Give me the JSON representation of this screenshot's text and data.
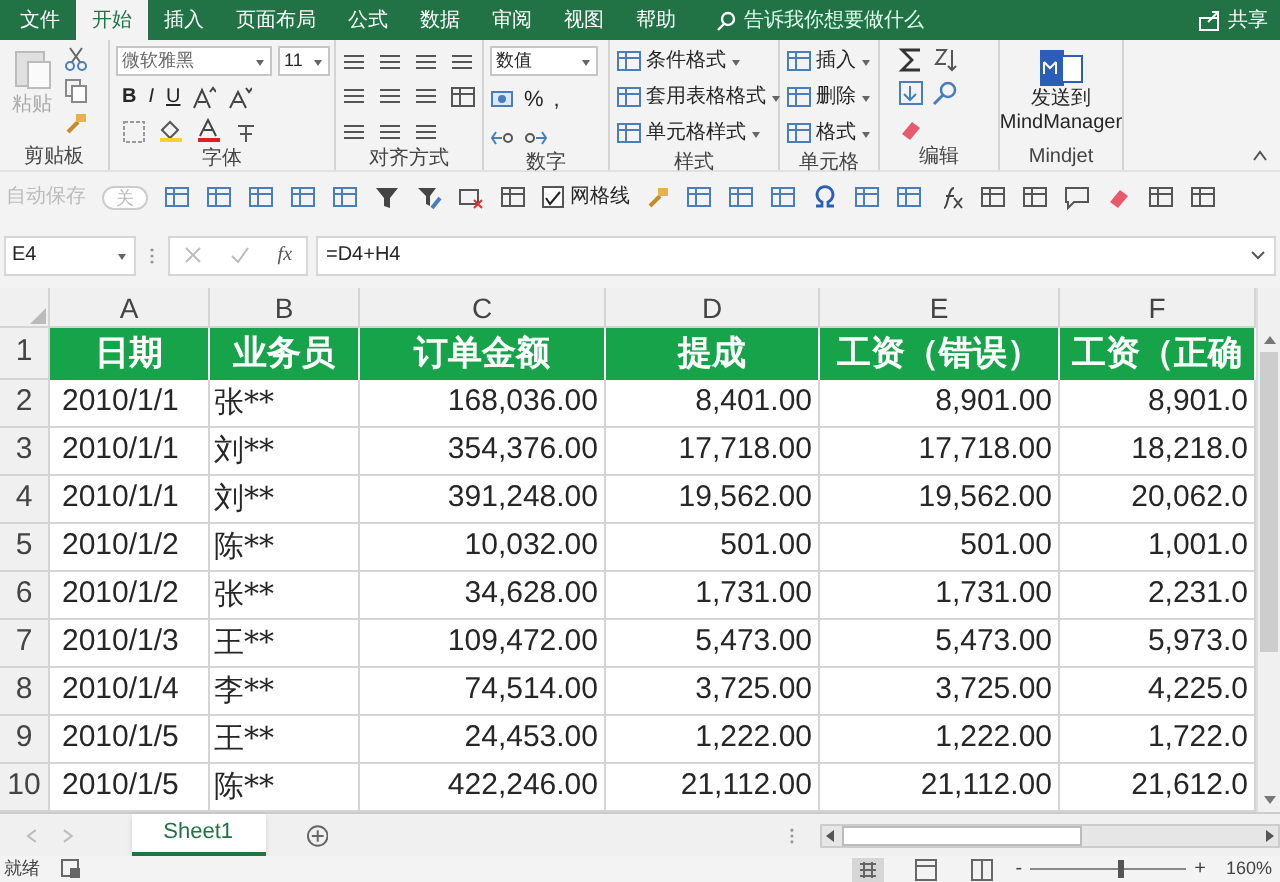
{
  "ribbon_tabs": [
    {
      "label": "文件",
      "selected": false
    },
    {
      "label": "开始",
      "selected": true
    },
    {
      "label": "插入",
      "selected": false
    },
    {
      "label": "页面布局",
      "selected": false
    },
    {
      "label": "公式",
      "selected": false
    },
    {
      "label": "数据",
      "selected": false
    },
    {
      "label": "审阅",
      "selected": false
    },
    {
      "label": "视图",
      "selected": false
    },
    {
      "label": "帮助",
      "selected": false
    }
  ],
  "tell_me": {
    "placeholder": "告诉我你想要做什么"
  },
  "share": "共享",
  "ribbon": {
    "clipboard": {
      "label": "剪贴板",
      "paste": "粘贴"
    },
    "font": {
      "label": "字体",
      "font_name": "微软雅黑",
      "font_size": "11",
      "styles": [
        "B",
        "I",
        "U"
      ]
    },
    "alignment": {
      "label": "对齐方式"
    },
    "number": {
      "label": "数字",
      "format": "数值",
      "symbols": [
        "%",
        ","
      ]
    },
    "styles": {
      "label": "样式",
      "items": [
        "条件格式",
        "套用表格格式",
        "单元格样式"
      ]
    },
    "cells": {
      "label": "单元格",
      "items": [
        "插入",
        "删除",
        "格式"
      ]
    },
    "editing": {
      "label": "编辑"
    },
    "mindjet": {
      "label": "Mindjet",
      "button": [
        "发送到",
        "MindManager"
      ]
    }
  },
  "quick_access": {
    "autosave": "自动保存",
    "autosave_toggle": "关",
    "gridlines": {
      "label": "网格线",
      "checked": true
    }
  },
  "formula_bar": {
    "name_box": "E4",
    "fx": "fx",
    "formula": "=D4+H4"
  },
  "sheet": {
    "columns": [
      "A",
      "B",
      "C",
      "D",
      "E",
      "F"
    ],
    "row_numbers": [
      "1",
      "2",
      "3",
      "4",
      "5",
      "6",
      "7",
      "8",
      "9",
      "10"
    ],
    "header": [
      "日期",
      "业务员",
      "订单金额",
      "提成",
      "工资（错误）",
      "工资（正确"
    ],
    "rows": [
      [
        "2010/1/1",
        "张**",
        "168,036.00",
        "8,401.00",
        "8,901.00",
        "8,901.0"
      ],
      [
        "2010/1/1",
        "刘**",
        "354,376.00",
        "17,718.00",
        "17,718.00",
        "18,218.0"
      ],
      [
        "2010/1/1",
        "刘**",
        "391,248.00",
        "19,562.00",
        "19,562.00",
        "20,062.0"
      ],
      [
        "2010/1/2",
        "陈**",
        "10,032.00",
        "501.00",
        "501.00",
        "1,001.0"
      ],
      [
        "2010/1/2",
        "张**",
        "34,628.00",
        "1,731.00",
        "1,731.00",
        "2,231.0"
      ],
      [
        "2010/1/3",
        "王**",
        "109,472.00",
        "5,473.00",
        "5,473.00",
        "5,973.0"
      ],
      [
        "2010/1/4",
        "李**",
        "74,514.00",
        "3,725.00",
        "3,725.00",
        "4,225.0"
      ],
      [
        "2010/1/5",
        "王**",
        "24,453.00",
        "1,222.00",
        "1,222.00",
        "1,722.0"
      ],
      [
        "2010/1/5",
        "陈**",
        "422,246.00",
        "21,112.00",
        "21,112.00",
        "21,612.0"
      ]
    ]
  },
  "sheet_tabs": [
    {
      "label": "Sheet1",
      "selected": true
    }
  ],
  "status_bar": {
    "status": "就绪",
    "zoom_out": "-",
    "zoom_in": "+",
    "zoom": {
      "level": 0.59
    },
    "zoom_text": "160%"
  }
}
